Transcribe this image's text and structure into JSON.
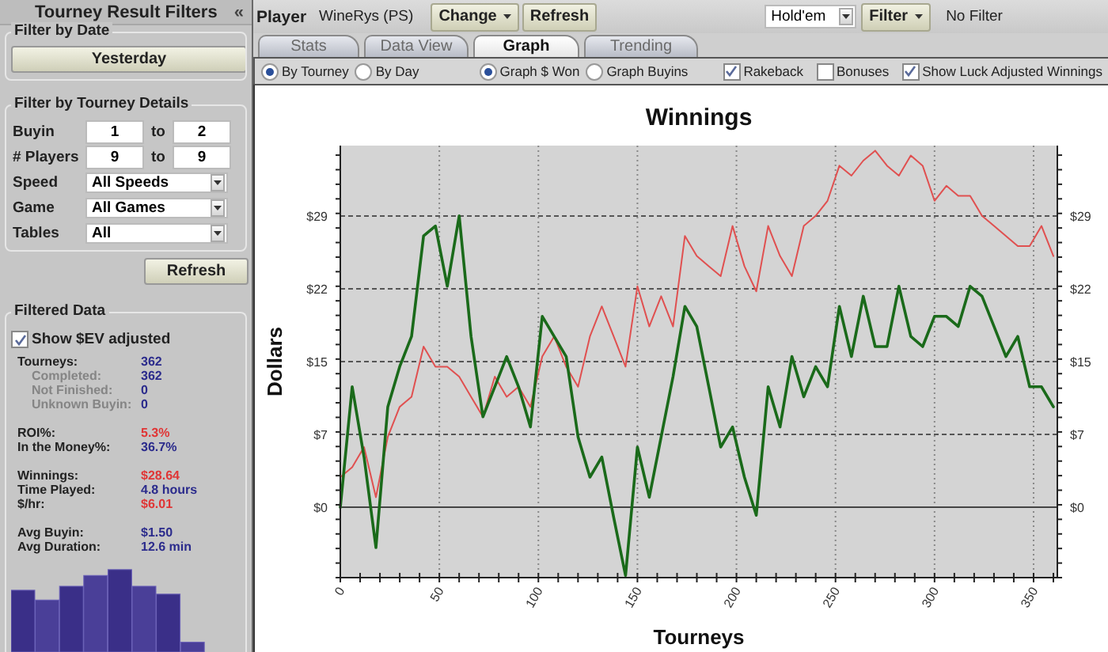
{
  "sidebar": {
    "title": "Tourney Result Filters",
    "collapse": "«",
    "date_filter": {
      "title": "Filter by Date",
      "button": "Yesterday"
    },
    "details_filter": {
      "title": "Filter by Tourney Details",
      "ranges": [
        {
          "label": "Buyin",
          "from": "1",
          "to_label": "to",
          "to": "2"
        },
        {
          "label": "# Players",
          "from": "9",
          "to_label": "to",
          "to": "9"
        }
      ],
      "selects": [
        {
          "label": "Speed",
          "value": "All Speeds"
        },
        {
          "label": "Game",
          "value": "All Games"
        },
        {
          "label": "Tables",
          "value": "All"
        }
      ]
    },
    "refresh": "Refresh",
    "filtered": {
      "title": "Filtered Data",
      "ev_checkbox": {
        "label": "Show $EV adjusted",
        "checked": true
      },
      "groups": [
        [
          {
            "label": "Tourneys:",
            "value": "362",
            "kind": "main",
            "color": "#2b2b8c"
          },
          {
            "label": "Completed:",
            "value": "362",
            "kind": "sub",
            "color": "#2b2b8c"
          },
          {
            "label": "Not Finished:",
            "value": "0",
            "kind": "sub",
            "color": "#2b2b8c"
          },
          {
            "label": "Unknown Buyin:",
            "value": "0",
            "kind": "sub",
            "color": "#2b2b8c"
          }
        ],
        [
          {
            "label": "ROI%:",
            "value": "5.3%",
            "kind": "main",
            "color": "#e03535"
          },
          {
            "label": "In the Money%:",
            "value": "36.7%",
            "kind": "main",
            "color": "#2b2b8c"
          }
        ],
        [
          {
            "label": "Winnings:",
            "value": "$28.64",
            "kind": "main",
            "color": "#e03535"
          },
          {
            "label": "Time Played:",
            "value": "4.8 hours",
            "kind": "main",
            "color": "#2b2b8c"
          },
          {
            "label": "$/hr:",
            "value": "$6.01",
            "kind": "main",
            "color": "#e03535"
          }
        ],
        [
          {
            "label": "Avg Buyin:",
            "value": "$1.50",
            "kind": "main",
            "color": "#2b2b8c"
          },
          {
            "label": "Avg Duration:",
            "value": "12.6 min",
            "kind": "main",
            "color": "#2b2b8c"
          }
        ]
      ]
    }
  },
  "toolbar": {
    "player_label": "Player",
    "player": "WineRys (PS)",
    "buttons": [
      {
        "label": "Change",
        "dropdown": true
      },
      {
        "label": "Refresh",
        "dropdown": false
      }
    ],
    "game": "Hold'em",
    "filter_button": {
      "label": "Filter",
      "dropdown": true
    },
    "filter_status": "No Filter"
  },
  "tabs": [
    {
      "label": "Stats",
      "selected": false
    },
    {
      "label": "Data View",
      "selected": false
    },
    {
      "label": "Graph",
      "selected": true
    },
    {
      "label": "Trending",
      "selected": false
    }
  ],
  "options": {
    "radio_groups": [
      [
        {
          "label": "By Tourney",
          "selected": true
        },
        {
          "label": "By Day",
          "selected": false
        }
      ],
      [
        {
          "label": "Graph $ Won",
          "selected": true
        },
        {
          "label": "Graph Buyins",
          "selected": false
        }
      ]
    ],
    "checkboxes": [
      {
        "label": "Rakeback",
        "checked": true
      },
      {
        "label": "Bonuses",
        "checked": false
      },
      {
        "label": "Show Luck Adjusted Winnings",
        "checked": true
      }
    ]
  },
  "chart": {
    "chart_data": {
      "type": "line",
      "title": "Winnings",
      "xlabel": "Tourneys",
      "ylabel": "Dollars",
      "x": [
        0,
        6,
        12,
        18,
        24,
        30,
        36,
        42,
        48,
        54,
        60,
        66,
        72,
        78,
        84,
        90,
        96,
        102,
        108,
        114,
        120,
        126,
        132,
        138,
        144,
        150,
        156,
        162,
        168,
        174,
        180,
        186,
        192,
        198,
        204,
        210,
        216,
        222,
        228,
        234,
        240,
        246,
        252,
        258,
        264,
        270,
        276,
        282,
        288,
        294,
        300,
        306,
        312,
        318,
        324,
        330,
        336,
        342,
        348,
        354,
        360
      ],
      "series": [
        {
          "color": "#e05050",
          "values": [
            3,
            4,
            6,
            1,
            7,
            10,
            11,
            16,
            14,
            14,
            13,
            11,
            9,
            13,
            11,
            12,
            10,
            15,
            17,
            14,
            12,
            17,
            20,
            17,
            14,
            22,
            18,
            21,
            18,
            27,
            25,
            24,
            23,
            28,
            24,
            21.5,
            28,
            25,
            23,
            28,
            29,
            30.5,
            34,
            33,
            34.5,
            35.5,
            34,
            33,
            35,
            34,
            30.5,
            32,
            31,
            31,
            29,
            28,
            27,
            26,
            26,
            28,
            25
          ]
        },
        {
          "color": "#1a6a1a",
          "values": [
            0,
            12,
            5,
            -4,
            10,
            14,
            17,
            27,
            28,
            22,
            29,
            17,
            9,
            12,
            15,
            12,
            8,
            19,
            17,
            15,
            7,
            3,
            5,
            -1,
            -6.8,
            6,
            1,
            7,
            13,
            20,
            18,
            12,
            6,
            8,
            3,
            -0.8,
            12,
            8,
            15,
            11,
            14,
            12,
            20,
            15,
            21,
            16,
            16,
            22,
            17,
            16,
            19,
            19,
            18,
            22,
            21,
            18,
            15,
            17,
            12,
            12,
            10
          ]
        }
      ],
      "grid": true,
      "xlim": [
        0,
        362
      ],
      "ylim": [
        -7,
        36
      ],
      "xticks": [
        0,
        50,
        100,
        150,
        200,
        250,
        300,
        350
      ],
      "yticks": [
        {
          "value": 0,
          "label": "$0"
        },
        {
          "value": 7.25,
          "label": "$7"
        },
        {
          "value": 14.5,
          "label": "$15"
        },
        {
          "value": 21.75,
          "label": "$22"
        },
        {
          "value": 29,
          "label": "$29"
        }
      ]
    }
  }
}
